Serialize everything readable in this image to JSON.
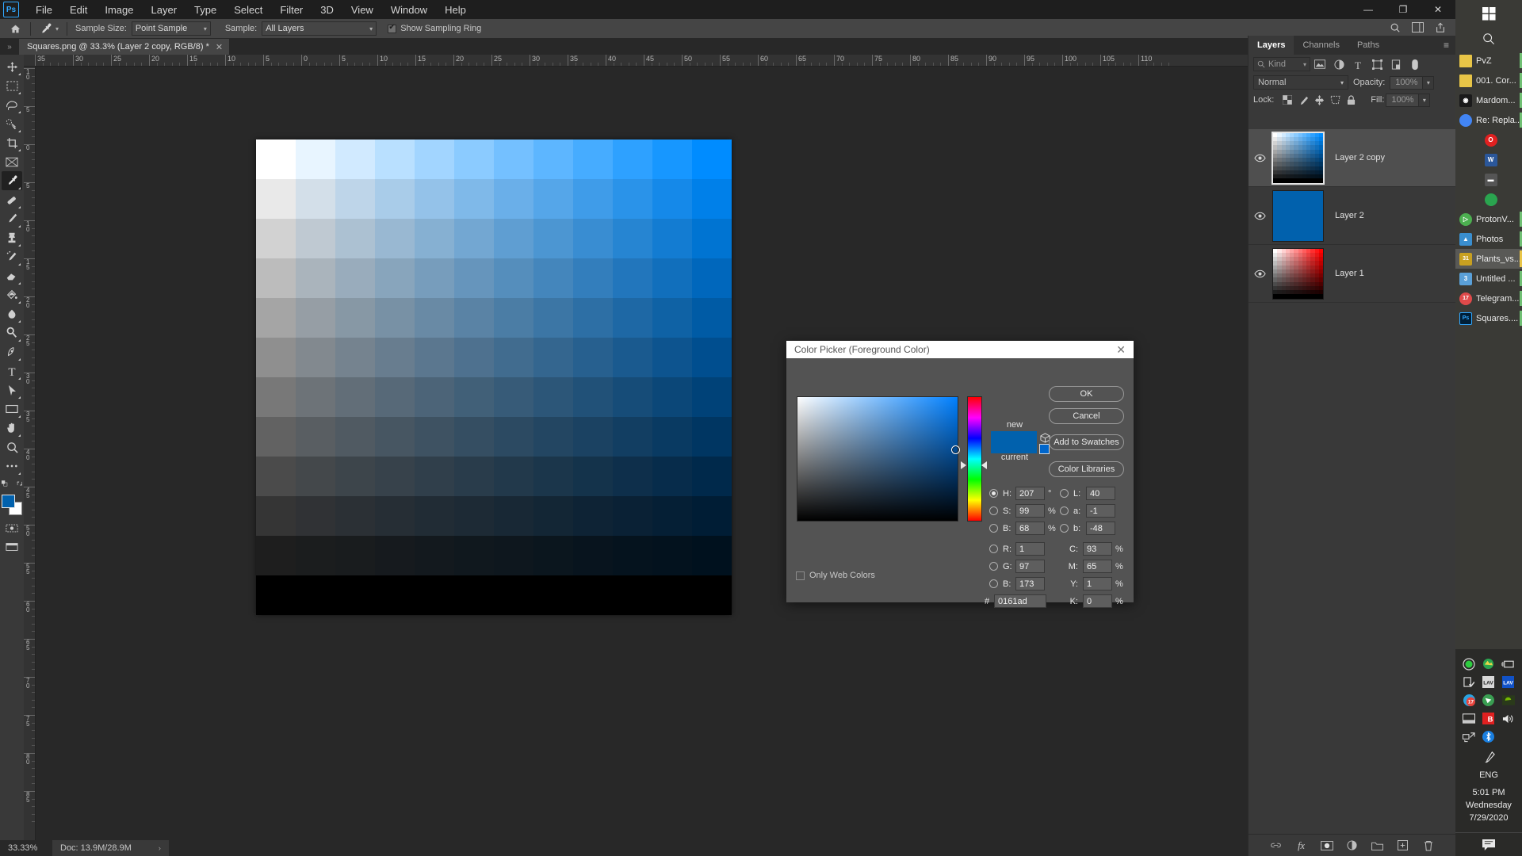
{
  "app": {
    "logo": "Ps",
    "menus": [
      "File",
      "Edit",
      "Image",
      "Layer",
      "Type",
      "Select",
      "Filter",
      "3D",
      "View",
      "Window",
      "Help"
    ],
    "window_controls": {
      "minimize": "—",
      "maximize": "❐",
      "close": "✕"
    }
  },
  "options_bar": {
    "home_icon": "home-icon",
    "tool_icon": "eyedropper-icon",
    "sample_size_label": "Sample Size:",
    "sample_size_value": "Point Sample",
    "sample_label": "Sample:",
    "sample_value": "All Layers",
    "show_sampling_ring_label": "Show Sampling Ring",
    "show_sampling_ring_checked": true,
    "right_icons": [
      "search-icon",
      "workspace-icon",
      "share-icon"
    ]
  },
  "document_tab": {
    "title": "Squares.png @ 33.3% (Layer 2 copy, RGB/8) *",
    "close_glyph": "✕",
    "expand_glyph": "»"
  },
  "toolbar": {
    "tools": [
      {
        "name": "move-tool",
        "active": false
      },
      {
        "name": "rectangular-marquee-tool",
        "active": false
      },
      {
        "name": "lasso-tool",
        "active": false
      },
      {
        "name": "quick-selection-tool",
        "active": false
      },
      {
        "name": "crop-tool",
        "active": false
      },
      {
        "name": "frame-tool",
        "active": false
      },
      {
        "name": "eyedropper-tool",
        "active": true
      },
      {
        "name": "spot-healing-brush-tool",
        "active": false
      },
      {
        "name": "brush-tool",
        "active": false
      },
      {
        "name": "clone-stamp-tool",
        "active": false
      },
      {
        "name": "history-brush-tool",
        "active": false
      },
      {
        "name": "eraser-tool",
        "active": false
      },
      {
        "name": "gradient-tool",
        "active": false
      },
      {
        "name": "blur-tool",
        "active": false
      },
      {
        "name": "dodge-tool",
        "active": false
      },
      {
        "name": "pen-tool",
        "active": false
      },
      {
        "name": "type-tool",
        "active": false
      },
      {
        "name": "path-selection-tool",
        "active": false
      },
      {
        "name": "rectangle-tool",
        "active": false
      },
      {
        "name": "hand-tool",
        "active": false
      },
      {
        "name": "zoom-tool",
        "active": false
      },
      {
        "name": "edit-toolbar-tool",
        "active": false
      }
    ],
    "foreground_color": "#0161ad",
    "background_color": "#ffffff"
  },
  "rulers": {
    "horizontal_ticks": [
      "35",
      "30",
      "25",
      "20",
      "15",
      "10",
      "5",
      "0",
      "5",
      "10",
      "15",
      "20",
      "25",
      "30",
      "35",
      "40",
      "45",
      "50",
      "55",
      "60",
      "65",
      "70",
      "75",
      "80",
      "85",
      "90",
      "95",
      "100",
      "105",
      "110"
    ],
    "vertical_ticks": [
      "10",
      "5",
      "0",
      "5",
      "10",
      "15",
      "20",
      "25",
      "30",
      "35",
      "40",
      "45",
      "50",
      "55",
      "60",
      "65",
      "70",
      "75",
      "80",
      "85"
    ]
  },
  "canvas": {
    "columns": 12,
    "rows": 12,
    "description": "blue saturation/brightness grid",
    "hue": 207
  },
  "layers_panel": {
    "tabs": [
      {
        "label": "Layers",
        "active": true
      },
      {
        "label": "Channels",
        "active": false
      },
      {
        "label": "Paths",
        "active": false
      }
    ],
    "menu_glyph": "≡",
    "filter_placeholder": "Kind",
    "filter_icons": [
      "pixel-layer-filter-icon",
      "adjustment-layer-filter-icon",
      "type-layer-filter-icon",
      "shape-layer-filter-icon",
      "smart-object-filter-icon",
      "filter-toggle-icon"
    ],
    "blend_mode": "Normal",
    "opacity_label": "Opacity:",
    "opacity_value": "100%",
    "lock_label": "Lock:",
    "lock_icons": [
      "lock-transparent-pixels-icon",
      "lock-image-pixels-icon",
      "lock-position-icon",
      "lock-artboard-icon",
      "lock-all-icon"
    ],
    "fill_label": "Fill:",
    "fill_value": "100%",
    "layers": [
      {
        "name": "Layer 2 copy",
        "visible": true,
        "selected": true,
        "thumb": "blue-grid"
      },
      {
        "name": "Layer 2",
        "visible": true,
        "selected": false,
        "thumb": "solid-blue"
      },
      {
        "name": "Layer 1",
        "visible": true,
        "selected": false,
        "thumb": "red-grid"
      }
    ],
    "bottom_icons": [
      "link-layers-icon",
      "add-layer-style-icon",
      "add-layer-mask-icon",
      "new-adjustment-layer-icon",
      "new-group-icon",
      "new-layer-icon",
      "delete-layer-icon"
    ]
  },
  "status_bar": {
    "zoom": "33.33%",
    "doc_info": "Doc: 13.9M/28.9M",
    "arrow_glyph": "›"
  },
  "color_picker": {
    "title": "Color Picker (Foreground Color)",
    "close_glyph": "✕",
    "new_label": "new",
    "current_label": "current",
    "new_color": "#0161ad",
    "current_color": "#0161ad",
    "buttons": [
      {
        "label": "OK",
        "primary": true
      },
      {
        "label": "Cancel",
        "primary": false
      },
      {
        "label": "Add to Swatches",
        "primary": false
      },
      {
        "label": "Color Libraries",
        "primary": false
      }
    ],
    "only_web_colors_label": "Only Web Colors",
    "only_web_colors_checked": false,
    "hsb": [
      {
        "key": "H",
        "value": "207",
        "unit": "°",
        "selected": true
      },
      {
        "key": "S",
        "value": "99",
        "unit": "%",
        "selected": false
      },
      {
        "key": "B",
        "value": "68",
        "unit": "%",
        "selected": false
      }
    ],
    "rgb": [
      {
        "key": "R",
        "value": "1",
        "unit": "",
        "selected": false
      },
      {
        "key": "G",
        "value": "97",
        "unit": "",
        "selected": false
      },
      {
        "key": "B",
        "value": "173",
        "unit": "",
        "selected": false
      }
    ],
    "lab": [
      {
        "key": "L",
        "value": "40",
        "unit": "",
        "selected": false
      },
      {
        "key": "a",
        "value": "-1",
        "unit": "",
        "selected": false
      },
      {
        "key": "b",
        "value": "-48",
        "unit": "",
        "selected": false
      }
    ],
    "cmyk": [
      {
        "key": "C",
        "value": "93",
        "unit": "%"
      },
      {
        "key": "M",
        "value": "65",
        "unit": "%"
      },
      {
        "key": "Y",
        "value": "1",
        "unit": "%"
      },
      {
        "key": "K",
        "value": "0",
        "unit": "%"
      }
    ],
    "hex_label": "#",
    "hex_value": "0161ad"
  },
  "taskbar": {
    "start_icon": "windows-start-icon",
    "search_icon": "search-icon",
    "items": [
      {
        "label": "PvZ",
        "icon": "folder-icon",
        "color": "#e8c547",
        "state": "running"
      },
      {
        "label": "001. Cor...",
        "icon": "folder-icon",
        "color": "#e8c547",
        "state": "running"
      },
      {
        "label": "Mardom...",
        "icon": "media-player-icon",
        "color": "#1a1a1a",
        "state": "running"
      },
      {
        "label": "Re: Repla...",
        "icon": "chrome-icon",
        "color": "#4285f4",
        "state": "running"
      },
      {
        "label": "",
        "icon": "opera-icon",
        "color": "#e02020",
        "state": "none"
      },
      {
        "label": "",
        "icon": "word-icon",
        "color": "#2b579a",
        "state": "none"
      },
      {
        "label": "",
        "icon": "keyboard-icon",
        "color": "#555555",
        "state": "none"
      },
      {
        "label": "",
        "icon": "photoshop-elements-icon",
        "color": "#2aa44f",
        "state": "none"
      },
      {
        "label": "ProtonV...",
        "icon": "protonvpn-icon",
        "color": "#4caf50",
        "state": "running"
      },
      {
        "label": "Photos",
        "icon": "photos-icon",
        "color": "#3a8fd0",
        "state": "running"
      },
      {
        "label": "Plants_vs...",
        "icon": "calendar-icon",
        "color": "#c8a020",
        "state": "active"
      },
      {
        "label": "Untitled ...",
        "icon": "notepad3-icon",
        "color": "#5aa0d8",
        "state": "running"
      },
      {
        "label": "Telegram...",
        "icon": "telegram-icon",
        "color": "#e04a4a",
        "state": "running"
      },
      {
        "label": "Squares....",
        "icon": "photoshop-icon",
        "color": "#001e36",
        "state": "running"
      }
    ],
    "tray_icons": [
      "record-indicator-icon",
      "photoshop-elements-tray-icon",
      "power-plug-icon",
      "usb-eject-icon",
      "lav-filters-splitter-icon",
      "lav-filters-video-icon",
      "telegram-tray-icon",
      "protonvpn-tray-icon",
      "nvidia-icon",
      "touchpad-icon",
      "bandicam-icon",
      "volume-icon",
      "network-icon",
      "bluetooth-icon"
    ],
    "pen_icon": "pen-tool-tray-icon",
    "language": "ENG",
    "time": "5:01 PM",
    "day": "Wednesday",
    "date": "7/29/2020",
    "notification_icon": "notification-icon"
  }
}
